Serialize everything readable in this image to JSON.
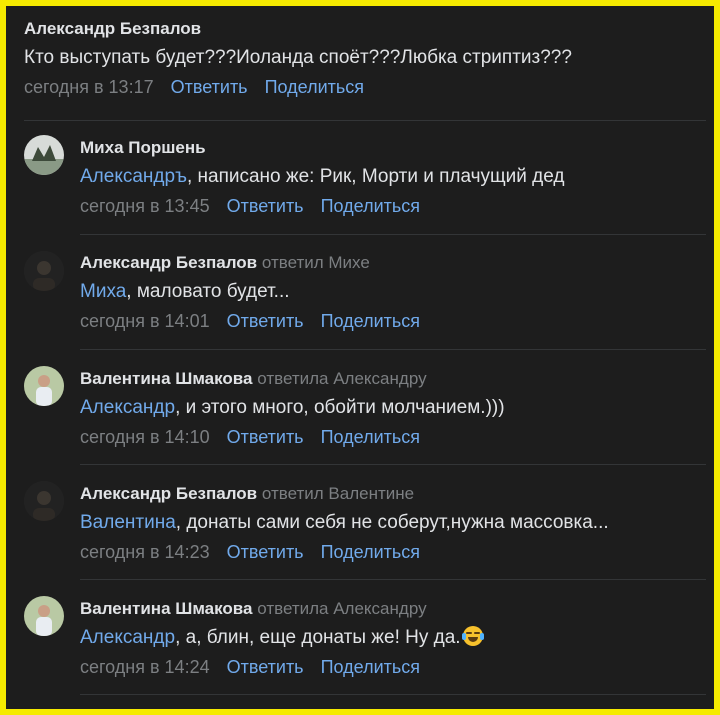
{
  "comments": [
    {
      "author": "Александр Безпалов",
      "replied": "",
      "mention": "",
      "text": "Кто выступать будет???Иоланда споёт???Любка стриптиз???",
      "time": "сегодня в 13:17",
      "reply_label": "Ответить",
      "share_label": "Поделиться"
    },
    {
      "author": "Миха Поршень",
      "replied": "",
      "mention": "Александръ",
      "text": ", написано же: Рик, Морти и плачущий дед",
      "time": "сегодня в 13:45",
      "reply_label": "Ответить",
      "share_label": "Поделиться"
    },
    {
      "author": "Александр Безпалов",
      "replied": "ответил Михе",
      "mention": "Миха",
      "text": ", маловато будет...",
      "time": "сегодня в 14:01",
      "reply_label": "Ответить",
      "share_label": "Поделиться"
    },
    {
      "author": "Валентина Шмакова",
      "replied": "ответила Александру",
      "mention": "Александр",
      "text": ", и этого много, обойти молчанием.)))",
      "time": "сегодня в 14:10",
      "reply_label": "Ответить",
      "share_label": "Поделиться"
    },
    {
      "author": "Александр Безпалов",
      "replied": "ответил Валентине",
      "mention": "Валентина",
      "text": ", донаты сами себя не соберут,нужна массовка...",
      "time": "сегодня в 14:23",
      "reply_label": "Ответить",
      "share_label": "Поделиться"
    },
    {
      "author": "Валентина Шмакова",
      "replied": "ответила Александру",
      "mention": "Александр",
      "text": ", а, блин, еще донаты же! Ну да.",
      "time": "сегодня в 14:24",
      "reply_label": "Ответить",
      "share_label": "Поделиться",
      "emoji": "face-with-tears-of-joy-icon"
    }
  ],
  "colors": {
    "background": "#1d1d1d",
    "border": "#f5ea00",
    "link": "#71aaeb",
    "text": "#e1e3e6",
    "muted": "#7c7f82"
  }
}
